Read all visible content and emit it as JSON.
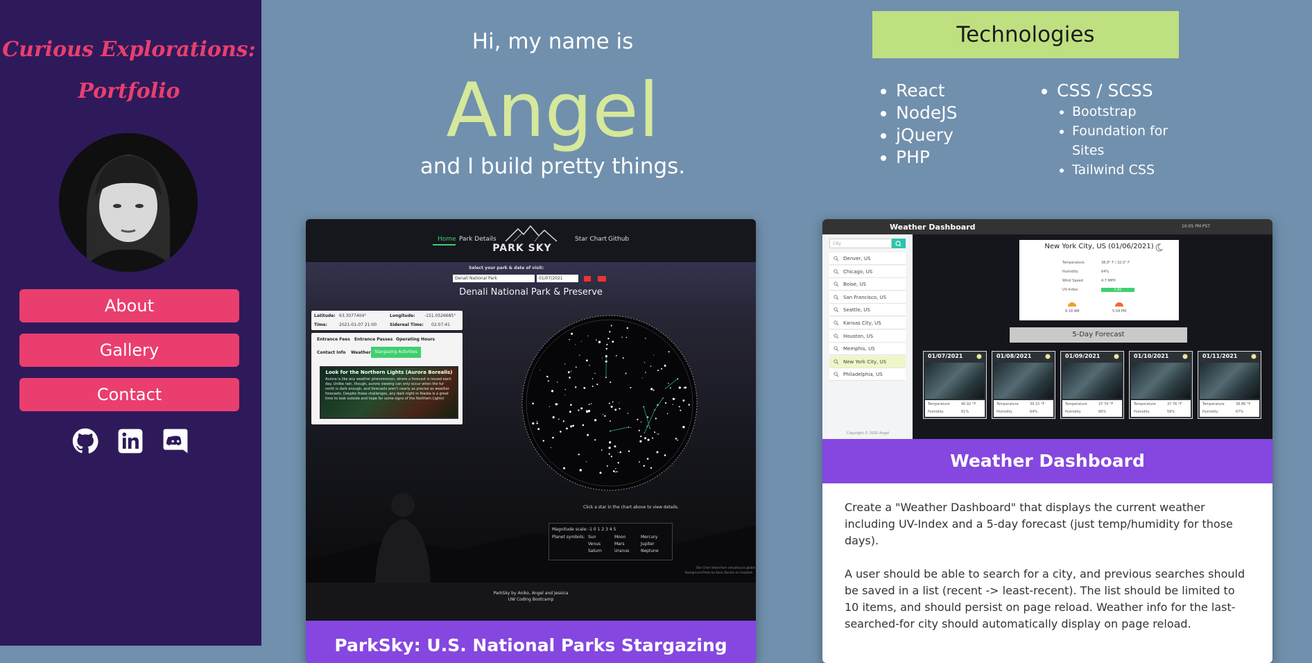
{
  "sidebar": {
    "brand_line1": "Curious Explorations:",
    "brand_line2": "Portfolio",
    "nav": [
      "About",
      "Gallery",
      "Contact"
    ],
    "social_icons": [
      "github-icon",
      "linkedin-icon",
      "discord-icon"
    ]
  },
  "hero": {
    "greeting": "Hi, my name is",
    "name": "Angel",
    "tagline": "and I build pretty things."
  },
  "technologies": {
    "heading": "Technologies",
    "col1": [
      "React",
      "NodeJS",
      "jQuery",
      "PHP"
    ],
    "col2_main": "CSS / SCSS",
    "col2_sub": [
      "Bootstrap",
      "Foundation for Sites",
      "Tailwind CSS"
    ]
  },
  "projects": [
    {
      "title": "ParkSky: U.S. National Parks Stargazing",
      "screenshot": {
        "nav": [
          "Home",
          "Park Details",
          "Star Chart",
          "Github"
        ],
        "logo": "PARK SKY",
        "select_label": "Select your park & date of visit:",
        "park_value": "Denali National Park",
        "date_value": "01/07/2021",
        "park_heading": "Denali National Park & Preserve",
        "latitude_label": "Latitude:",
        "latitude_value": "63.3077404°",
        "longitude_label": "Longitude:",
        "longitude_value": "-151.0526685°",
        "time_label": "Time:",
        "time_value": "2021-01-07 21:00",
        "sidereal_label": "Sidereal Time:",
        "sidereal_value": "02:07:41",
        "tabs": [
          "Entrance Fees",
          "Entrance Passes",
          "Operating Hours",
          "Contact Info",
          "Weather",
          "Stargazing Activities"
        ],
        "aurora_title": "Look for the Northern Lights (Aurora Borealis)",
        "aurora_text": "Aurora is like any weather phenomenon, where a forecast is issued each day. Unlike rain, though, aurora viewing can only occur when the fur north is dark enough, and forecasts aren't nearly as precise as weather forecasts. Despite these challenges, any dark night in Alaska is a great time to look outside and hope for some signs of the Northern Lights!",
        "chart_hint": "Click a star in the chart above to view details.",
        "magnitude_label": "Magnitude scale:",
        "magnitude_values": "-1 0 1 2 3 4 5",
        "planet_label": "Planet symbols:",
        "planets": [
          "Sun",
          "Moon",
          "Mercury",
          "Venus",
          "Mars",
          "Jupiter",
          "Saturn",
          "Uranus",
          "Neptune"
        ],
        "footer_line1": "ParkSky by Aniko, Angel and Jessica",
        "footer_line2": "UW Coding Bootcamp",
        "credit": "Star Chart linked from virtualsky.lco.global",
        "bg_credit": "Background Photo by Aaron Burden on Unsplash"
      }
    },
    {
      "title": "Weather Dashboard",
      "description": [
        "Create a \"Weather Dashboard\" that displays the current weather including UV-Index and a 5-day forecast (just temp/humidity for those days).",
        "A user should be able to search for a city, and previous searches should be saved in a list (recent -> least-recent). The list should be limited to 10 items, and should persist on page reload. Weather info for the last-searched-for city should automatically display on page reload."
      ],
      "screenshot": {
        "app_title": "Weather Dashboard",
        "clock": "10:05 PM PST",
        "search_placeholder": "City",
        "cities": [
          "Denver, US",
          "Chicago, US",
          "Boise, US",
          "San Francisco, US",
          "Seattle, US",
          "Kansas City, US",
          "Houston, US",
          "Memphis, US",
          "New York City, US",
          "Philadelphia, US"
        ],
        "current_city": "New York City, US (01/06/2021)",
        "current_rows": [
          {
            "label": "Temperature",
            "value": "38.8° F / 32.0° F"
          },
          {
            "label": "Humidity",
            "value": "64%"
          },
          {
            "label": "Wind Speed",
            "value": "4.7 MPH"
          },
          {
            "label": "UV-Index",
            "value": "1.91"
          }
        ],
        "sunrise": "6:18 AM",
        "sunset": "5:04 PM",
        "forecast_label": "5-Day Forecast",
        "days": [
          {
            "date": "01/07/2021",
            "temp": "40.92 °F",
            "humidity": "61%"
          },
          {
            "date": "01/08/2021",
            "temp": "39.15 °F",
            "humidity": "64%"
          },
          {
            "date": "01/09/2021",
            "temp": "37.74 °F",
            "humidity": "66%"
          },
          {
            "date": "01/10/2021",
            "temp": "37.76 °F",
            "humidity": "59%"
          },
          {
            "date": "01/11/2021",
            "temp": "38.86 °F",
            "humidity": "67%"
          }
        ],
        "temp_label": "Temperature",
        "humidity_label": "Humidity",
        "copyright": "Copyright © 2020 Angel"
      }
    }
  ],
  "colors": {
    "background": "#7190ad",
    "sidebar": "#2e1a5a",
    "accent_pink": "#ea3e6f",
    "name_green": "#d5e89c",
    "tech_header": "#bfe080",
    "card_title": "#8547e0"
  }
}
